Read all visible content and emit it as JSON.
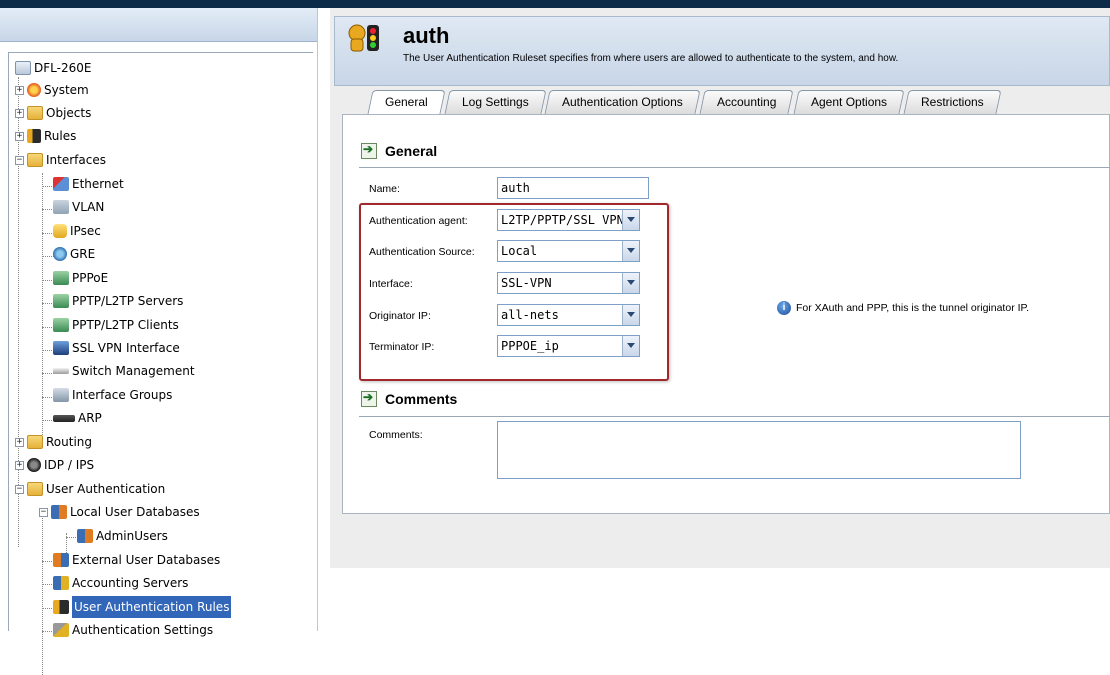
{
  "tree": {
    "root": "DFL-260E",
    "items": [
      {
        "label": "System"
      },
      {
        "label": "Objects"
      },
      {
        "label": "Rules"
      },
      {
        "label": "Interfaces"
      },
      {
        "label": "Ethernet"
      },
      {
        "label": "VLAN"
      },
      {
        "label": "IPsec"
      },
      {
        "label": "GRE"
      },
      {
        "label": "PPPoE"
      },
      {
        "label": "PPTP/L2TP Servers"
      },
      {
        "label": "PPTP/L2TP Clients"
      },
      {
        "label": "SSL VPN Interface"
      },
      {
        "label": "Switch Management"
      },
      {
        "label": "Interface Groups"
      },
      {
        "label": "ARP"
      },
      {
        "label": "Routing"
      },
      {
        "label": "IDP / IPS"
      },
      {
        "label": "User Authentication"
      },
      {
        "label": "Local User Databases"
      },
      {
        "label": "AdminUsers"
      },
      {
        "label": "External User Databases"
      },
      {
        "label": "Accounting Servers"
      },
      {
        "label": "User Authentication Rules"
      },
      {
        "label": "Authentication Settings"
      }
    ]
  },
  "header": {
    "title": "auth",
    "description": "The User Authentication Ruleset specifies from where users are allowed to authenticate to the system, and how."
  },
  "tabs": [
    "General",
    "Log Settings",
    "Authentication Options",
    "Accounting",
    "Agent Options",
    "Restrictions"
  ],
  "general": {
    "section_title": "General",
    "name_label": "Name:",
    "name_value": "auth",
    "agent_label": "Authentication agent:",
    "agent_value": "L2TP/PPTP/SSL VPN",
    "source_label": "Authentication Source:",
    "source_value": "Local",
    "interface_label": "Interface:",
    "interface_value": "SSL-VPN",
    "originator_label": "Originator IP:",
    "originator_value": "all-nets",
    "terminator_label": "Terminator IP:",
    "terminator_value": "PPPOE_ip",
    "info_text": "For XAuth and PPP, this is the tunnel originator IP."
  },
  "comments": {
    "section_title": "Comments",
    "label": "Comments:",
    "value": ""
  }
}
